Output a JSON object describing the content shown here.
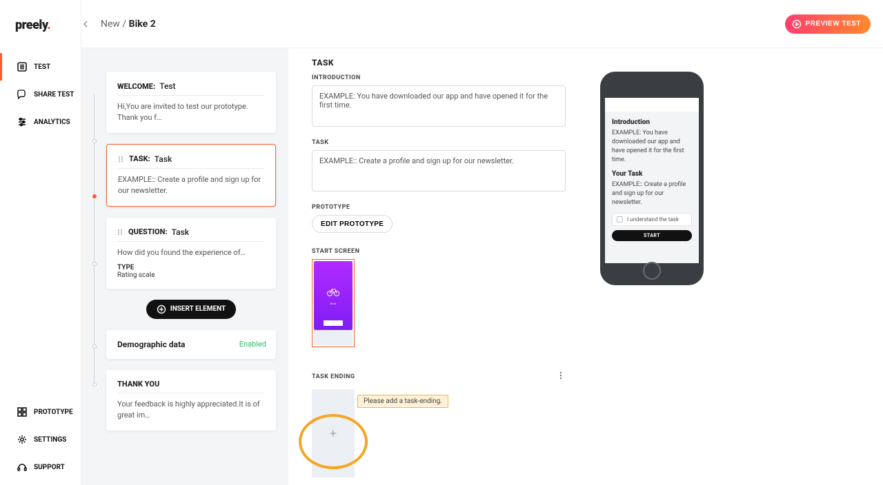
{
  "brand": {
    "name": "preely"
  },
  "breadcrumb": {
    "root": "New",
    "current": "Bike 2"
  },
  "header": {
    "preview_button": "PREVIEW TEST"
  },
  "sidebar": {
    "top": [
      {
        "label": "TEST"
      },
      {
        "label": "SHARE TEST"
      },
      {
        "label": "ANALYTICS"
      }
    ],
    "bottom": [
      {
        "label": "PROTOTYPE"
      },
      {
        "label": "SETTINGS"
      },
      {
        "label": "SUPPORT"
      }
    ]
  },
  "elements": {
    "welcome": {
      "kind": "WELCOME:",
      "subject": "Test",
      "desc": "Hi,You are invited to test our prototype. Thank you f…"
    },
    "task": {
      "kind": "TASK:",
      "subject": "Task",
      "desc": "EXAMPLE:: Create a profile and sign up for our newsletter."
    },
    "question": {
      "kind": "QUESTION:",
      "subject": "Task",
      "desc": "How did you found the experience of…",
      "type_label": "TYPE",
      "type_value": "Rating scale"
    },
    "insert_label": "INSERT ELEMENT",
    "demographic": {
      "title": "Demographic data",
      "status": "Enabled"
    },
    "thankyou": {
      "title": "THANK YOU",
      "desc": "Your feedback is highly appreciated.It is of great im…"
    }
  },
  "editor": {
    "title": "TASK",
    "intro_label": "INTRODUCTION",
    "intro_value": "EXAMPLE: You have downloaded our app and have opened it for the first time.",
    "task_label": "TASK",
    "task_value": "EXAMPLE:: Create a profile and sign up for our newsletter.",
    "prototype_label": "PROTOTYPE",
    "edit_prototype": "EDIT PROTOTYPE",
    "start_screen_label": "START SCREEN",
    "task_ending_label": "TASK ENDING",
    "ending_tooltip": "Please add a task-ending."
  },
  "phone_preview": {
    "intro_h": "Introduction",
    "intro_p": "EXAMPLE: You have downloaded our app and have opened it for the first time.",
    "task_h": "Your Task",
    "task_p": "EXAMPLE:: Create a profile and sign up for our newsletter.",
    "understand": "I understand the task",
    "start": "START"
  }
}
